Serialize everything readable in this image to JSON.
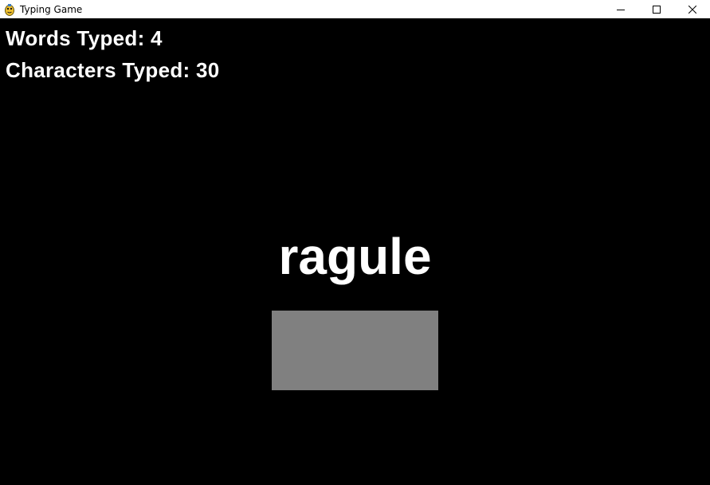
{
  "window": {
    "title": "Typing Game",
    "app_icon": "pygame-snake-icon",
    "controls": {
      "minimize_icon": "minimize-icon",
      "maximize_icon": "maximize-icon",
      "close_icon": "close-icon"
    }
  },
  "game": {
    "words_typed_label": "Words Typed: 4",
    "characters_typed_label": "Characters Typed: 30",
    "current_word": "ragule",
    "input_value": "",
    "colors": {
      "background": "#000000",
      "text": "#ffffff",
      "input_box": "#808080"
    }
  }
}
